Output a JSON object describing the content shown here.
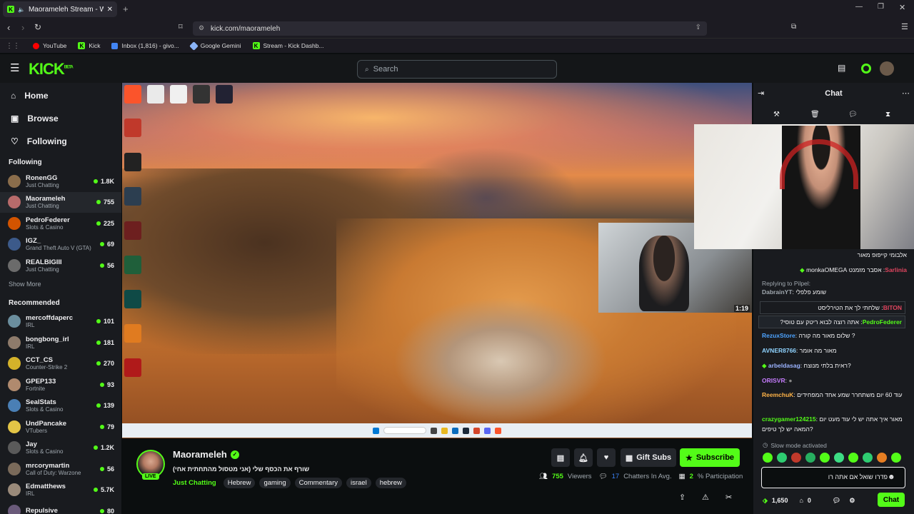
{
  "browser": {
    "tab_title": "Maorameleh Stream - Watch",
    "url": "kick.com/maorameleh",
    "bookmarks": [
      "YouTube",
      "Kick",
      "Inbox (1,816) - givo...",
      "Google Gemini",
      "Stream - Kick Dashb..."
    ]
  },
  "header": {
    "logo": "KICK",
    "beta": "BETA",
    "search_placeholder": "Search"
  },
  "sidebar": {
    "nav": [
      "Home",
      "Browse",
      "Following"
    ],
    "following_heading": "Following",
    "following": [
      {
        "name": "RonenGG",
        "category": "Just Chatting",
        "viewers": "1.8K",
        "color": "#8a6d4b"
      },
      {
        "name": "Maorameleh",
        "category": "Just Chatting",
        "viewers": "755",
        "color": "#b86b6b"
      },
      {
        "name": "PedroFederer",
        "category": "Slots & Casino",
        "viewers": "225",
        "color": "#d35400"
      },
      {
        "name": "IGZ_",
        "category": "Grand Theft Auto V (GTA)",
        "viewers": "69",
        "color": "#3c5a8a"
      },
      {
        "name": "REALBIGIII",
        "category": "Just Chatting",
        "viewers": "56",
        "color": "#6b6b6b"
      }
    ],
    "show_more": "Show More",
    "recommended_heading": "Recommended",
    "recommended": [
      {
        "name": "mercoffdaperc",
        "category": "IRL",
        "viewers": "101",
        "color": "#6b8e9e"
      },
      {
        "name": "bongbong_irl",
        "category": "IRL",
        "viewers": "181",
        "color": "#8e7b6b"
      },
      {
        "name": "CCT_CS",
        "category": "Counter-Strike 2",
        "viewers": "270",
        "color": "#d4b22a"
      },
      {
        "name": "GPEP133",
        "category": "Fortnite",
        "viewers": "93",
        "color": "#b08a6e"
      },
      {
        "name": "SealStats",
        "category": "Slots & Casino",
        "viewers": "139",
        "color": "#4a7fb5"
      },
      {
        "name": "UndPancake",
        "category": "VTubers",
        "viewers": "79",
        "color": "#e3c546"
      },
      {
        "name": "Jay",
        "category": "Slots & Casino",
        "viewers": "1.2K",
        "color": "#5a5a5a"
      },
      {
        "name": "mrcorymartin",
        "category": "Call of Duty: Warzone",
        "viewers": "56",
        "color": "#7a6a5a"
      },
      {
        "name": "Edmatthews",
        "category": "IRL",
        "viewers": "5.7K",
        "color": "#9a8a7a"
      },
      {
        "name": "Repulsive",
        "category": "",
        "viewers": "80",
        "color": "#6a5a7a"
      }
    ]
  },
  "stream": {
    "live_badge": "LIVE",
    "cam_badge": "1:19",
    "streamer": "Maorameleh",
    "title": "שורף את הכסף שלי (אני מטסול מהתחתית אחי)",
    "category": "Just Chatting",
    "tags": [
      "Hebrew",
      "gaming",
      "Commentary",
      "israel",
      "hebrew"
    ],
    "viewers": "755",
    "viewers_label": "Viewers",
    "chatters_avg": "17",
    "chatters_label": "Chatters In Avg.",
    "participation": "2",
    "participation_label": "% Participation",
    "gift_subs": "Gift Subs",
    "subscribe": "Subscribe"
  },
  "chat": {
    "title": "Chat",
    "messages": [
      {
        "user": "",
        "text": "אלבומי קייפופ מאור",
        "color": "#efeff1"
      },
      {
        "user": "Sarlinia",
        "text": "אסבר מזמנט monkaOMEGA",
        "color": "#e0455f"
      },
      {
        "user": "",
        "text": "Replying to Pilpel:",
        "color": "#a0a8af"
      },
      {
        "user": "DabrainYT",
        "text": "שומע פלפלי",
        "color": "#a0a8af"
      },
      {
        "user": "BITON",
        "text": "שלחתי לך את הטירליסט",
        "color": "#e0455f"
      },
      {
        "user": "PedroFederer",
        "text": "אתה רוצה לבוא ריטק עם טוסי?",
        "color": "#53fc18"
      },
      {
        "user": "RezuxStore",
        "text": "שלום מאור מה קורה ?",
        "color": "#4da3ff"
      },
      {
        "user": "AVNER8766",
        "text": "מאור מה אומר",
        "color": "#8fd3ff"
      },
      {
        "user": "arbeldasag",
        "text": "ראית בלתי מנוצח?",
        "color": "#9bb3ff"
      },
      {
        "user": "ORISVR",
        "text": "",
        "color": "#c77dff"
      },
      {
        "user": "ReemchuK",
        "text": "עוד 60 יום משתחרר שמע אחד המפחידים",
        "color": "#ffb347"
      },
      {
        "user": "crazygamer124215",
        "text": "מאור איך אתה יש לי עוד מעט יום המאה יש לך טיפים?",
        "color": "#53fc18"
      }
    ],
    "slow_mode": "Slow mode activated",
    "input_value": "פדרו שואל אם אתה רו",
    "points": "1,650",
    "count": "0",
    "send": "Chat"
  }
}
